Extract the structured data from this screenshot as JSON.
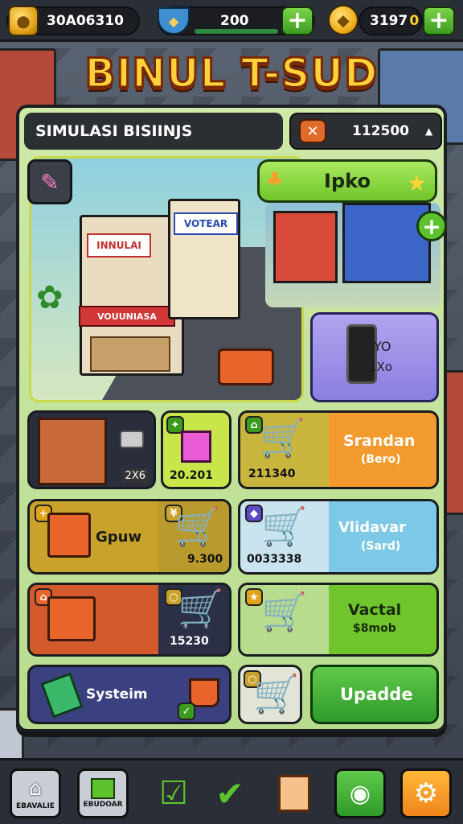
{
  "header": {
    "gold": "30A06310",
    "food": "200",
    "gems": "3197",
    "gems_suffix": "0"
  },
  "title": "BINUL T-SUD",
  "panel": {
    "subtitle": "SIMULASI BISIINJS",
    "budget": "112500",
    "budget_arrow": "▲"
  },
  "scene": {
    "sign_left": "INNULAI",
    "sign_right": "VOTEAR",
    "sign_front": "VOUUNIASA",
    "ipko_label": "Ipko",
    "phone_line1": "YO",
    "phone_line2": "1Xo"
  },
  "cards": {
    "shop_count": "2X6",
    "mag_value": "20.201",
    "standard_value": "211340",
    "standard_label": "Srandan",
    "standard_sub": "(Bero)",
    "gpuw_label": "Gpuw",
    "gpuw_value": "9.300",
    "vlida_value": "0033338",
    "vlida_label": "Vlidavar",
    "vlida_sub": "(Sard)",
    "register_value": "15230",
    "vactal_label": "Vactal",
    "vactal_sub": "$8mob",
    "system_label": "Systeim",
    "update_label": "Upadde"
  },
  "nav": {
    "home_caption": "EBAVALIE",
    "book_caption": "EBUDOAR"
  },
  "colors": {
    "accent_green": "#6fc52b",
    "accent_orange": "#f29a2e",
    "title_yellow": "#ffd23a"
  }
}
